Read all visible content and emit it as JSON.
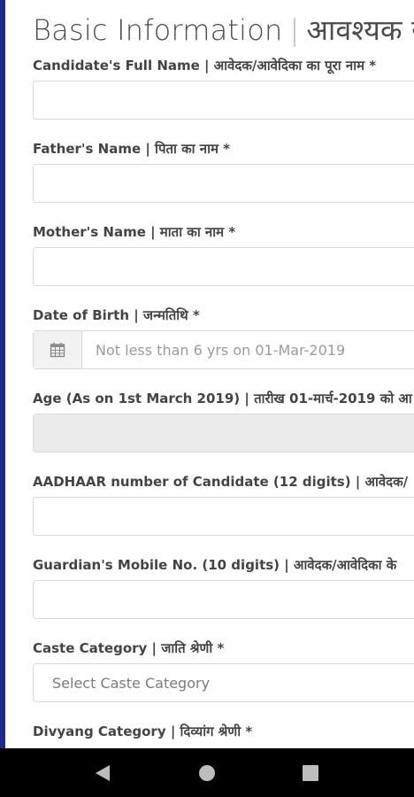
{
  "heading": {
    "title": "Basic Information",
    "separator": "|",
    "title_hindi": "आवश्यक स"
  },
  "fields": {
    "full_name_label": "Candidate's Full Name | आवेदक/आवेदिका का पूरा नाम *",
    "father_label": "Father's Name | पिता का नाम *",
    "mother_label": "Mother's Name | माता का नाम *",
    "dob_label": "Date of Birth | जन्मतिथि *",
    "dob_placeholder": "Not less than 6 yrs on 01-Mar-2019",
    "age_label": "Age (As on 1st March 2019) | तारीख 01-मार्च-2019 को आ",
    "aadhaar_label": "AADHAAR number of Candidate (12 digits) | आवेदक/",
    "mobile_label": "Guardian's Mobile No. (10 digits) | आवेदक/आवेदिका के",
    "caste_label": "Caste Category | जाति श्रेणी *",
    "caste_placeholder": "Select Caste Category",
    "divyang_label": "Divyang Category | दिव्यांग श्रेणी *"
  },
  "icons": {
    "calendar": "calendar-icon",
    "back": "back-triangle-icon",
    "home": "home-circle-icon",
    "recents": "recents-square-icon"
  },
  "colors": {
    "left_bar": "#1f2a8c",
    "navbar": "#000000",
    "readonly_bg": "#ebebeb"
  }
}
